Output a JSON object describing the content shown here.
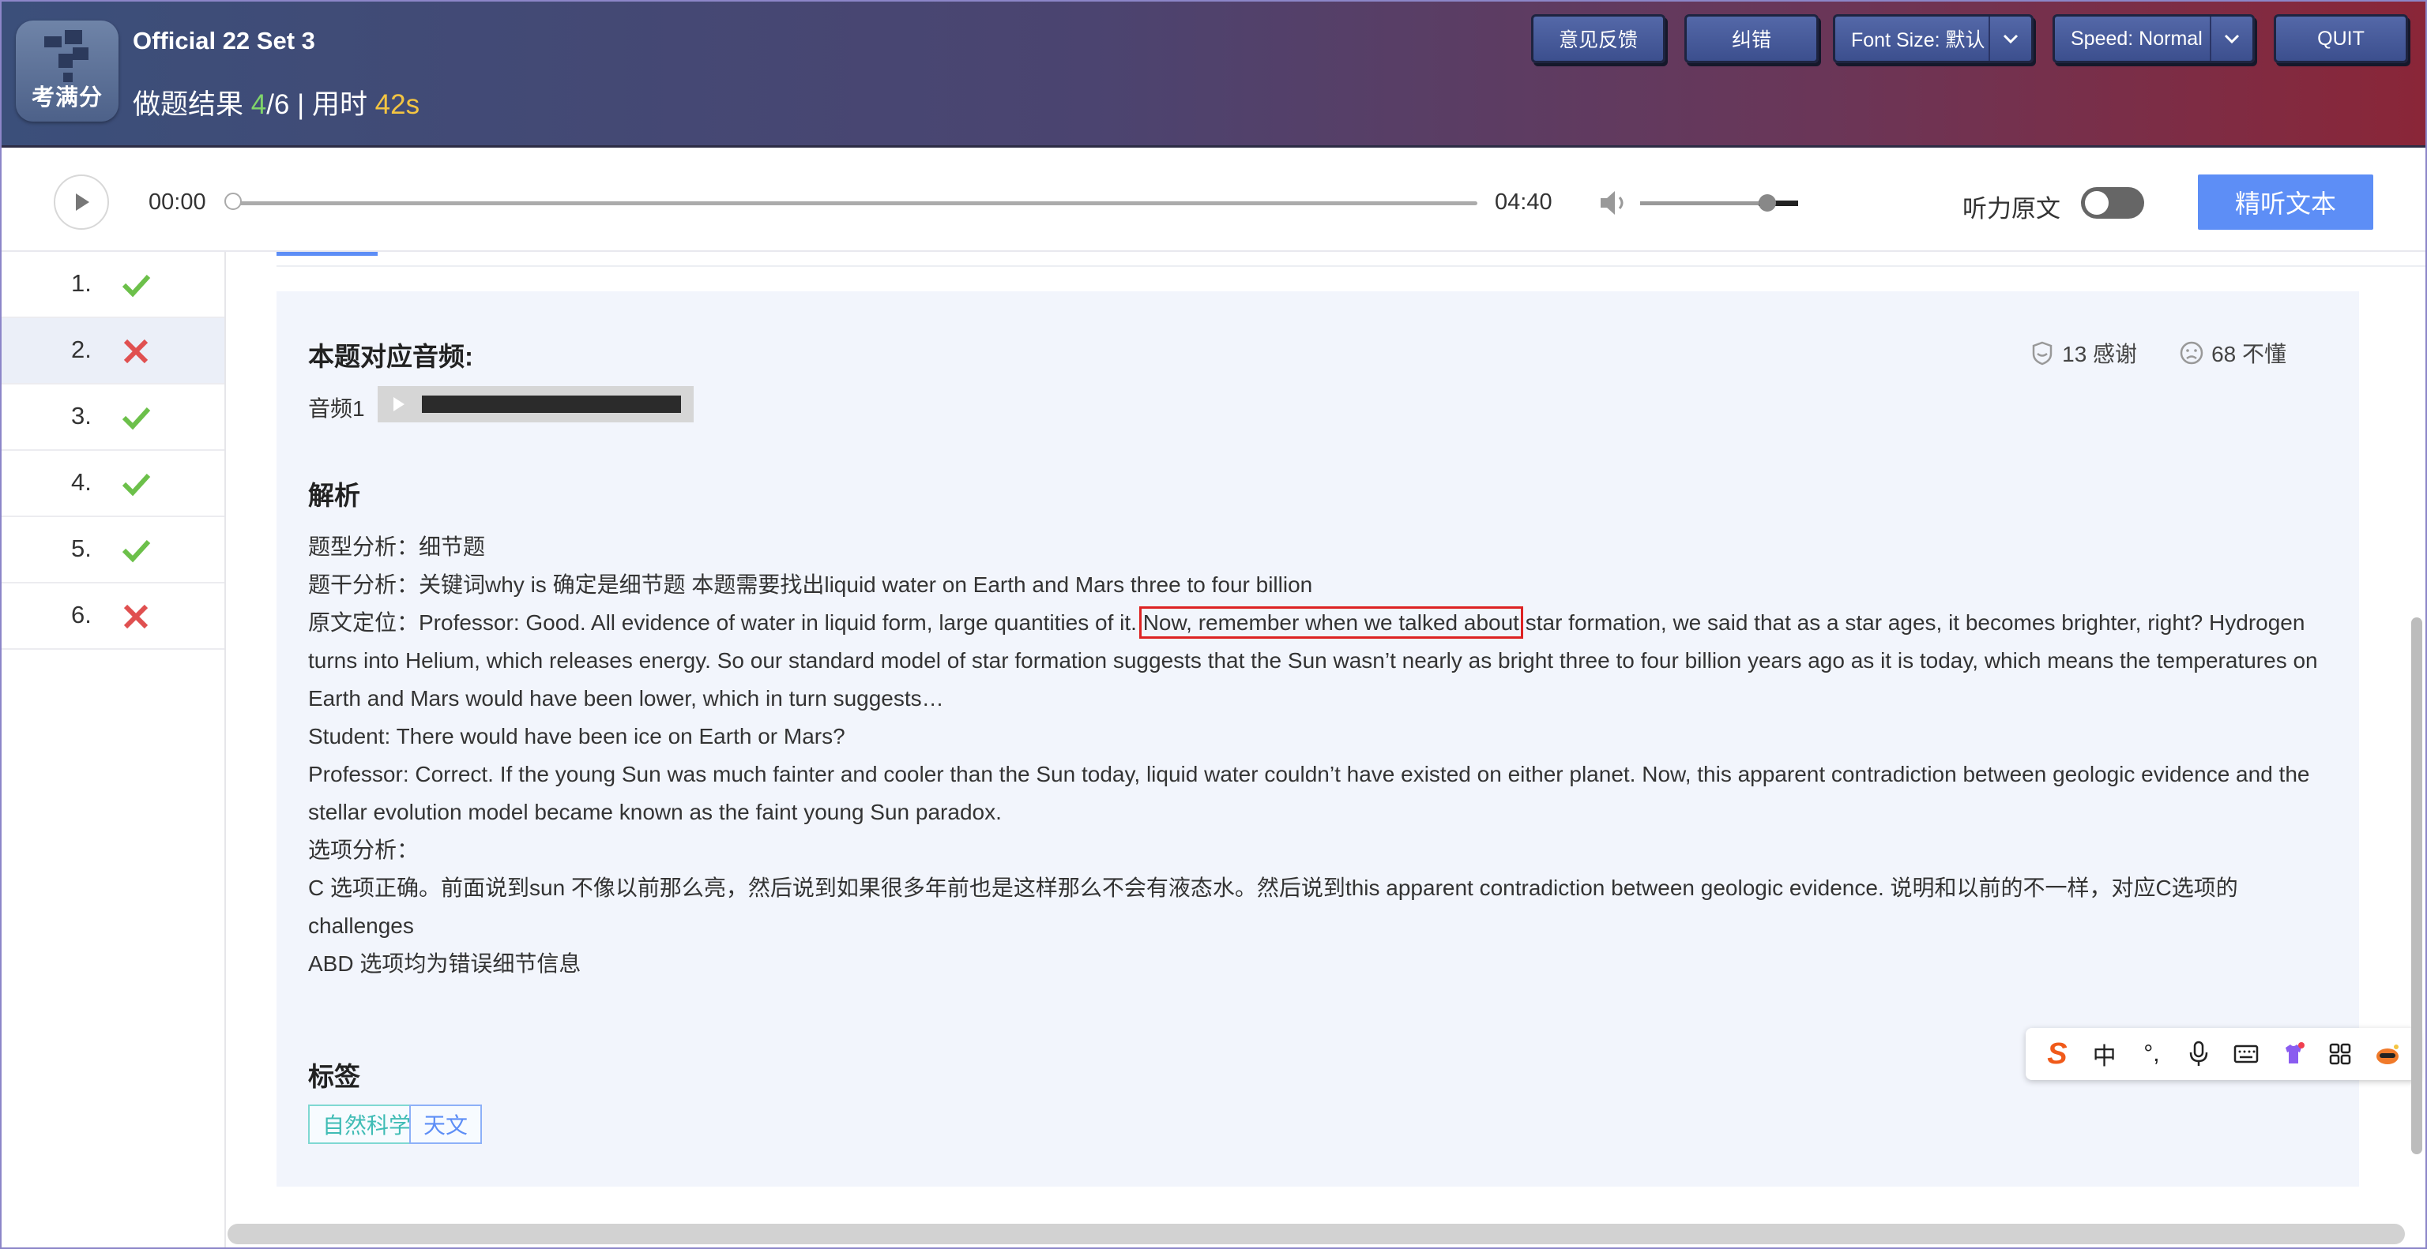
{
  "header": {
    "logo_text": "考满分",
    "title": "Official 22 Set 3",
    "result_prefix": "做题结果 ",
    "result_correct": "4",
    "result_total": "/6",
    "result_sep": " | 用时 ",
    "result_time": "42s",
    "buttons": {
      "feedback": "意见反馈",
      "correction": "纠错",
      "font_size": "Font Size: 默认",
      "speed": "Speed: Normal",
      "quit": "QUIT"
    }
  },
  "audio": {
    "current_time": "00:00",
    "duration": "04:40",
    "progress": 0,
    "volume": 0.75,
    "original_text_label": "听力原文",
    "original_text_on": false,
    "listen_button": "精听文本"
  },
  "questions": [
    {
      "num": "1.",
      "status": "correct"
    },
    {
      "num": "2.",
      "status": "wrong",
      "active": true
    },
    {
      "num": "3.",
      "status": "correct"
    },
    {
      "num": "4.",
      "status": "correct"
    },
    {
      "num": "5.",
      "status": "correct"
    },
    {
      "num": "6.",
      "status": "wrong"
    }
  ],
  "content": {
    "audio_heading": "本题对应音频:",
    "thanks": "13 感谢",
    "confused": "68 不懂",
    "audio_label": "音频1",
    "analysis_heading": "解析",
    "line1": "题型分析：细节题",
    "line2": "题干分析：关键词why is 确定是细节题 本题需要找出liquid water on Earth and Mars three to four billion",
    "line3_before": "原文定位：Professor: Good. All evidence of water in liquid form, large quantities of it. ",
    "line3_highlight": "Now, remember when we talked about",
    "line3_after": " star formation, we said that as a star ages, it becomes brighter, right? Hydrogen turns into Helium, which releases energy. So our standard model of star formation suggests that the Sun wasn’t nearly as bright three to four billion years ago as it is today, which means the temperatures on Earth and Mars would have been lower, which in turn suggests…",
    "line4": "Student: There would have been ice on Earth or Mars?",
    "line5": "Professor: Correct. If the young Sun was much fainter and cooler than the Sun today, liquid water couldn’t have existed on either planet. Now, this apparent contradiction between geologic evidence and the stellar evolution model became known as the faint young Sun paradox.",
    "line6": "选项分析：",
    "line7": "C 选项正确。前面说到sun 不像以前那么亮，然后说到如果很多年前也是这样那么不会有液态水。然后说到this apparent contradiction between geologic evidence. 说明和以前的不一样，对应C选项的challenges",
    "line8": "ABD 选项均为错误细节信息",
    "tags_heading": "标签",
    "tags": [
      "自然科学",
      "天文"
    ]
  },
  "ime": {
    "logo": "S",
    "lang": "中",
    "punct": "°,"
  },
  "colors": {
    "accent": "#5d8ef6",
    "correct": "#6cc04a",
    "wrong": "#e05050",
    "highlight_border": "#dd2222"
  }
}
